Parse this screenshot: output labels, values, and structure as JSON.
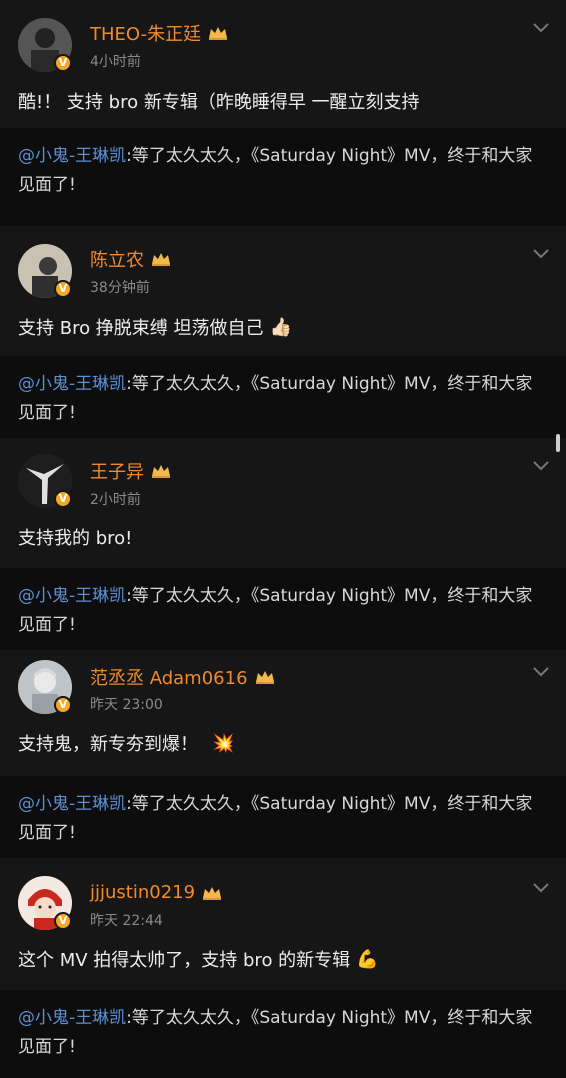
{
  "comments": [
    {
      "user": "THEO-朱正廷",
      "time": "4小时前",
      "text": "酷!！ 支持 bro 新专辑（昨晚睡得早 一醒立刻支持",
      "emoji": "",
      "verified_icon": "verified-v-icon",
      "quote": {
        "mention": "@小鬼-王琳凯",
        "text": ":等了太久太久，《Saturday Night》MV，终于和大家见面了!"
      }
    },
    {
      "user": "陈立农",
      "time": "38分钟前",
      "text": "支持 Bro 挣脱束缚 坦荡做自己",
      "emoji": "👍🏻",
      "verified_icon": "verified-v-icon",
      "quote": {
        "mention": "@小鬼-王琳凯",
        "text": ":等了太久太久，《Saturday Night》MV，终于和大家见面了!"
      }
    },
    {
      "user": "王子异",
      "time": "2小时前",
      "text": "支持我的 bro!",
      "emoji": "",
      "verified_icon": "verified-v-icon",
      "quote": {
        "mention": "@小鬼-王琳凯",
        "text": ":等了太久太久，《Saturday Night》MV，终于和大家见面了!"
      }
    },
    {
      "user": "范丞丞 Adam0616",
      "time": "昨天 23:00",
      "text": "支持鬼，新专夯到爆！",
      "emoji": "💥",
      "verified_icon": "verified-v-icon",
      "quote": {
        "mention": "@小鬼-王琳凯",
        "text": ":等了太久太久，《Saturday Night》MV，终于和大家见面了!"
      }
    },
    {
      "user": "jjjustin0219",
      "time": "昨天 22:44",
      "text": "这个 MV 拍得太帅了，支持 bro 的新专辑",
      "emoji": "💪",
      "verified_icon": "verified-v-icon",
      "quote": {
        "mention": "@小鬼-王琳凯",
        "text": ":等了太久太久，《Saturday Night》MV，终于和大家见面了!"
      }
    }
  ],
  "colors": {
    "username": "#f08a2c",
    "mention": "#5b8fd6",
    "card_bg": "#161616",
    "quote_bg": "#0d0d0d",
    "badge": "#f5a623"
  },
  "icons": [
    "crown-icon",
    "chevron-down-icon",
    "verified-v-icon"
  ]
}
